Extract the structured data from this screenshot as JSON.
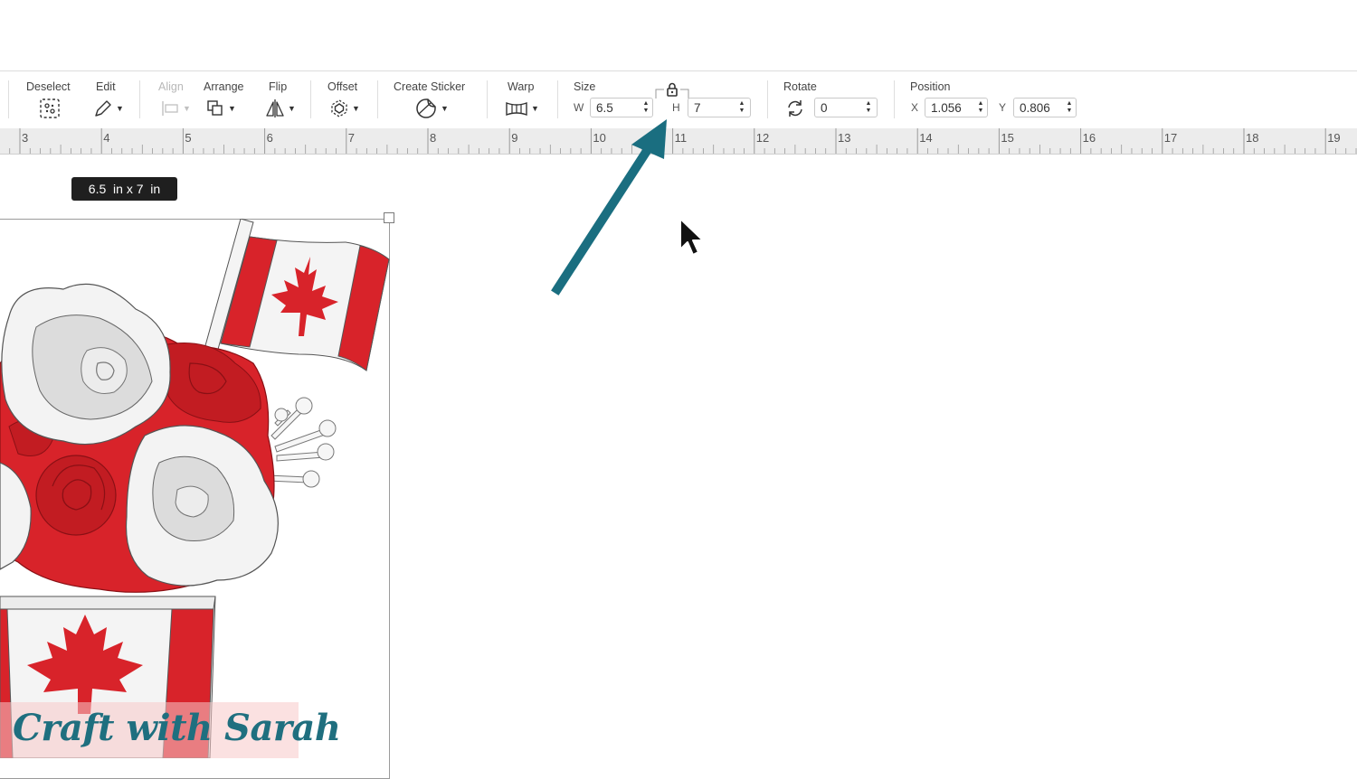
{
  "toolbar": {
    "deselect": "Deselect",
    "edit": "Edit",
    "align": "Align",
    "arrange": "Arrange",
    "flip": "Flip",
    "offset": "Offset",
    "create_sticker": "Create Sticker",
    "warp": "Warp",
    "size": {
      "label": "Size",
      "w_letter": "W",
      "w_value": "6.5",
      "h_letter": "H",
      "h_value": "7",
      "lock_icon": "lock-icon"
    },
    "rotate": {
      "label": "Rotate",
      "value": "0"
    },
    "position": {
      "label": "Position",
      "x_letter": "X",
      "x_value": "1.056",
      "y_letter": "Y",
      "y_value": "0.806"
    }
  },
  "ruler": {
    "labels": [
      "3",
      "4",
      "5",
      "6",
      "7",
      "8",
      "9",
      "10",
      "11",
      "12",
      "13",
      "14",
      "15",
      "16",
      "17",
      "18",
      "19"
    ]
  },
  "canvas": {
    "size_tooltip": "6.5  in x 7  in",
    "annotation_arrow_color": "#1a6e80"
  },
  "colors": {
    "red": "#d8232a",
    "white_petal": "#f2f2f2",
    "accent_teal": "#1a6e80"
  },
  "watermark": {
    "text": "Craft with Sarah"
  }
}
